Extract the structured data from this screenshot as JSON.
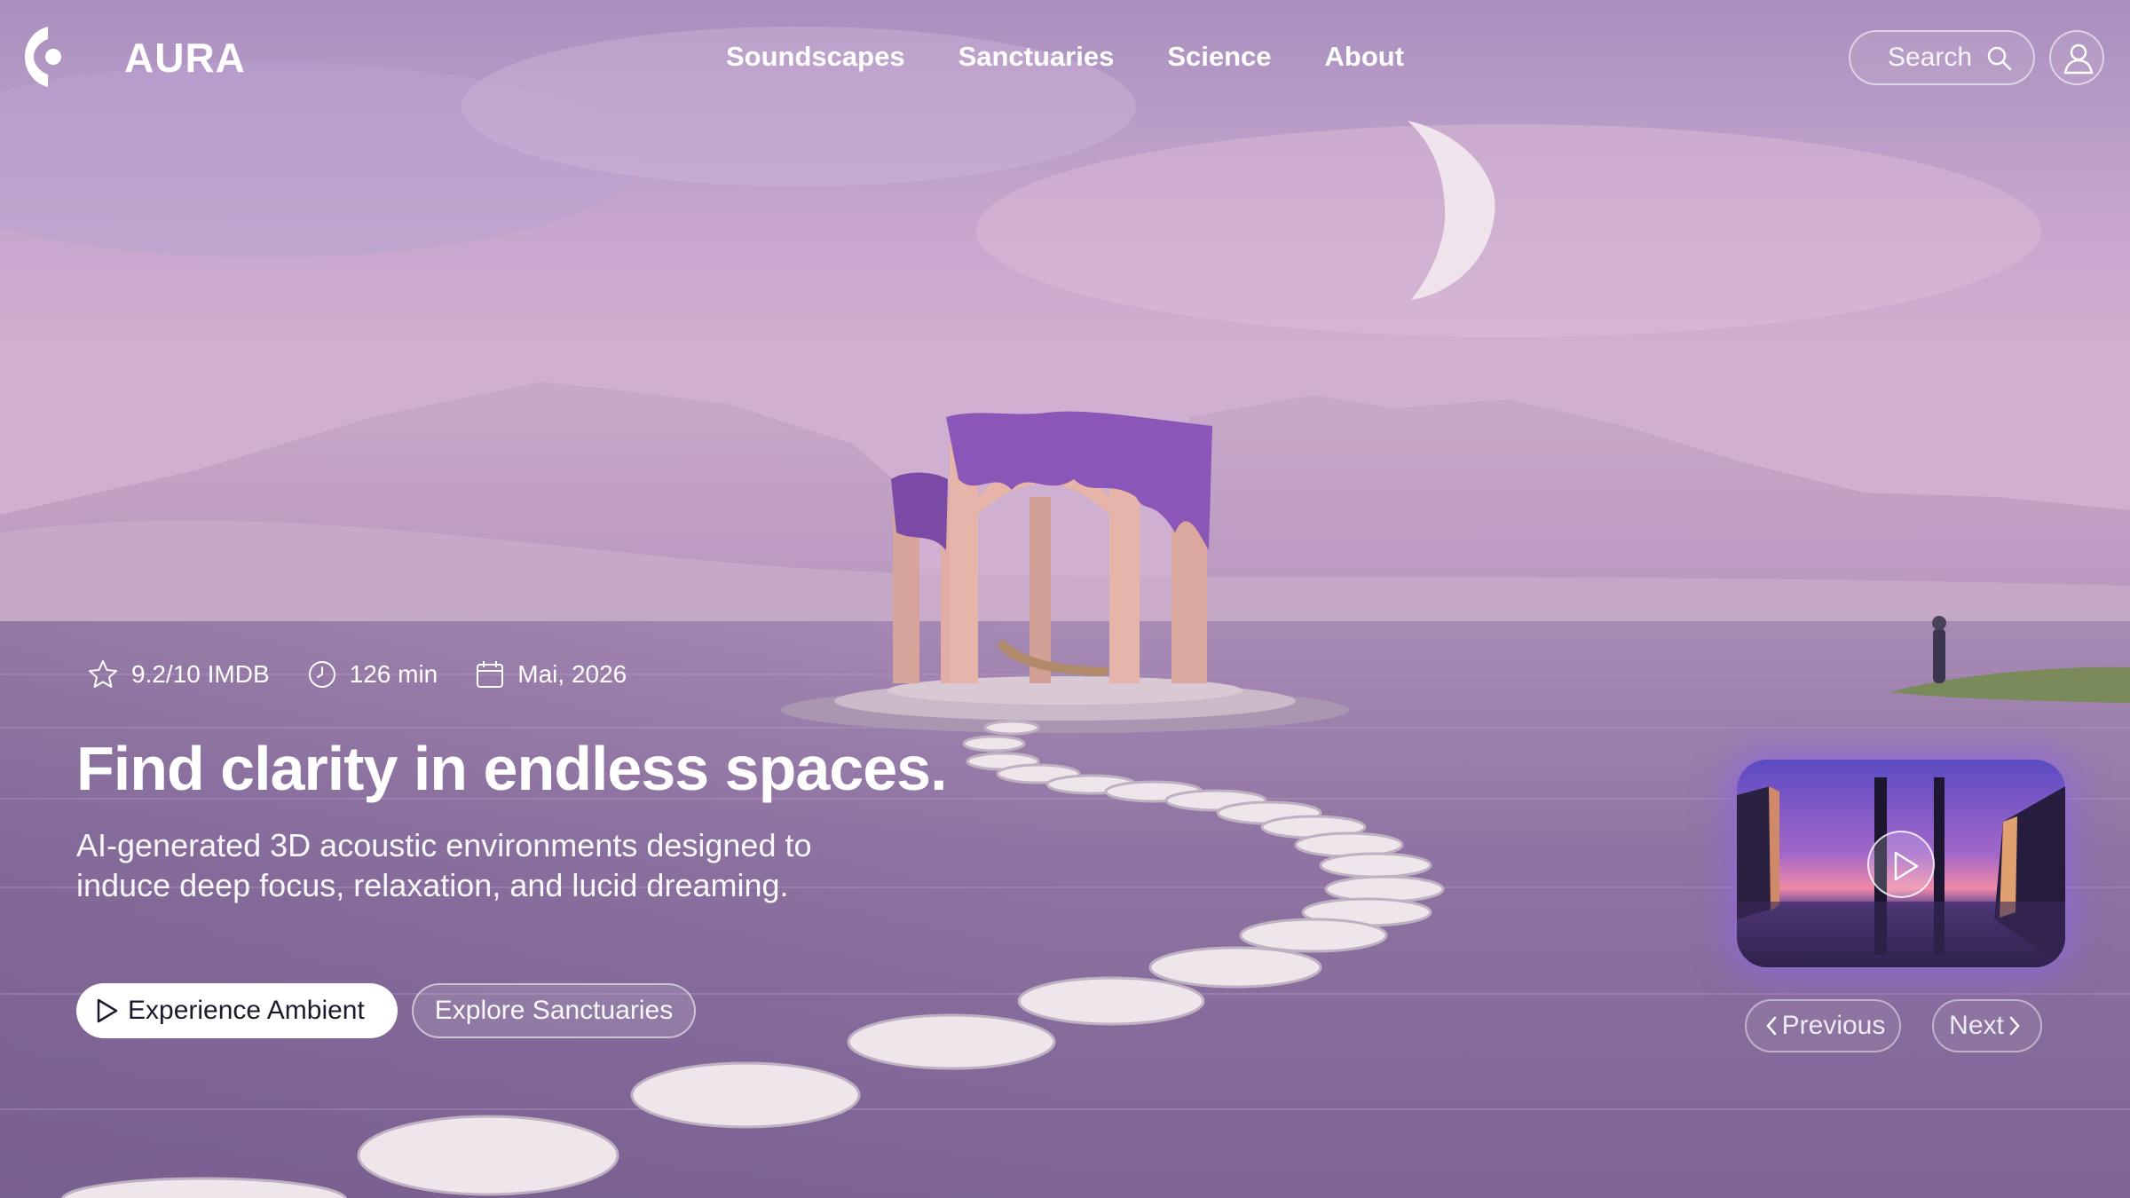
{
  "brand": {
    "name": "AURA"
  },
  "nav": {
    "items": [
      {
        "label": "Soundscapes"
      },
      {
        "label": "Sanctuaries"
      },
      {
        "label": "Science"
      },
      {
        "label": "About"
      }
    ]
  },
  "search": {
    "label": "Search",
    "icon": "search-icon"
  },
  "user": {
    "icon": "user-icon"
  },
  "hero": {
    "meta": {
      "rating": "9.2/10 IMDB",
      "duration": "126 min",
      "date": "Mai, 2026"
    },
    "headline": "Find clarity in endless spaces.",
    "subheadline": "AI-generated 3D acoustic environments designed to induce deep focus, relaxation, and lucid dreaming.",
    "primary_button": "Experience Ambient",
    "secondary_button": "Explore Sanctuaries"
  },
  "carousel": {
    "previous_label": "Previous",
    "next_label": "Next"
  },
  "colors": {
    "sky_top": "#b49ac9",
    "sky_mid": "#c9a7cf",
    "water": "#8a6fa0",
    "accent_glow": "#8c64e6",
    "wisteria": "#8a56b8",
    "pavilion": "#d9a79e"
  }
}
